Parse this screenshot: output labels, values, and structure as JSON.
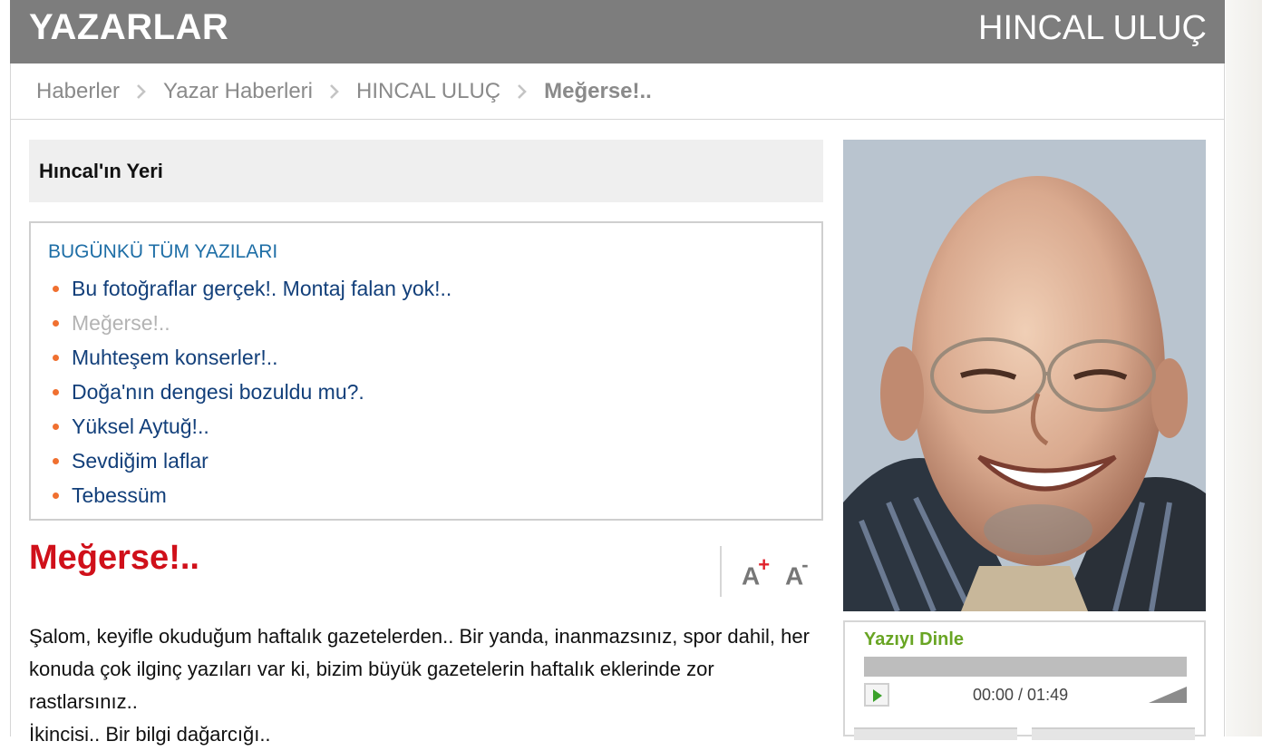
{
  "header": {
    "section_title": "YAZARLAR",
    "author_name": "HINCAL ULUÇ"
  },
  "breadcrumb": {
    "items": [
      "Haberler",
      "Yazar Haberleri",
      "HINCAL ULUÇ"
    ],
    "current": "Meğerse!.."
  },
  "sidebar_box": {
    "title": "Hıncal'ın Yeri"
  },
  "todays_articles": {
    "heading": "BUGÜNKÜ TÜM YAZILARI",
    "items": [
      {
        "label": "Bu fotoğraflar gerçek!. Montaj falan yok!..",
        "active": false
      },
      {
        "label": "Meğerse!..",
        "active": true
      },
      {
        "label": "Muhteşem konserler!..",
        "active": false
      },
      {
        "label": "Doğa'nın dengesi bozuldu mu?.",
        "active": false
      },
      {
        "label": "Yüksel Aytuğ!..",
        "active": false
      },
      {
        "label": "Sevdiğim laflar",
        "active": false
      },
      {
        "label": "Tebessüm",
        "active": false
      }
    ]
  },
  "article": {
    "title": "Meğerse!..",
    "font_increase_label": "A",
    "font_decrease_label": "A",
    "paragraphs": [
      "Şalom, keyifle okuduğum haftalık gazetelerden.. Bir yanda, inanmazsınız, spor dahil, her konuda çok ilginç yazıları var ki, bizim büyük gazetelerin haftalık eklerinde zor rastlarsınız..",
      "İkincisi.. Bir bilgi dağarcığı.."
    ]
  },
  "audio_player": {
    "title": "Yazıyı Dinle",
    "time": "00:00 / 01:49"
  },
  "colors": {
    "header_bg": "#7d7d7d",
    "title_red": "#d0101a",
    "link_blue": "#123f7a",
    "heading_blue": "#1e6ea6",
    "bullet_orange": "#f07030",
    "audio_green": "#69a524"
  },
  "icons": [
    "chevron-right-icon",
    "play-icon",
    "volume-icon"
  ]
}
